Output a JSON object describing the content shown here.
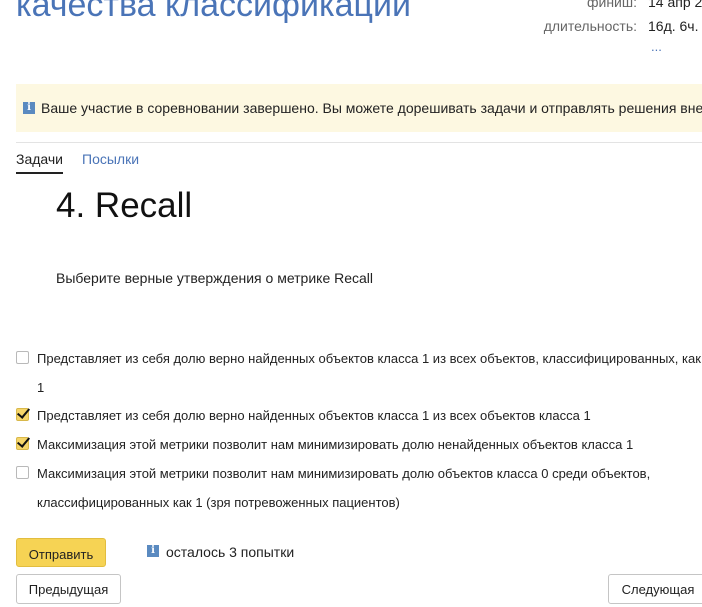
{
  "header": {
    "contest_title": "качества классификации",
    "finish_label": "финиш:",
    "finish_value": "14 апр 2",
    "duration_label": "длительность:",
    "duration_value": "16д. 6ч.",
    "more": "..."
  },
  "notice": {
    "icon": "info-icon",
    "text": "Ваше участие в соревновании завершено. Вы можете дорешивать задачи и отправлять решения вне"
  },
  "tabs": [
    {
      "label": "Задачи",
      "active": true
    },
    {
      "label": "Посылки",
      "active": false
    }
  ],
  "problem": {
    "title": "4. Recall",
    "statement": "Выберите верные утверждения о метрике Recall"
  },
  "options": [
    {
      "text": "Представляет из себя долю верно найденных объектов класса 1 из всех объектов, классифицированных, как 1",
      "checked": false
    },
    {
      "text": "Представляет из себя долю верно найденных объектов класса 1 из всех объектов класса 1",
      "checked": true
    },
    {
      "text": "Максимизация этой метрики позволит нам минимизировать долю ненайденных объектов класса 1",
      "checked": true
    },
    {
      "text": "Максимизация этой метрики позволит нам минимизировать долю объектов класса 0 среди объектов, классифицированных как 1 (зря потревоженных пациентов)",
      "checked": false
    }
  ],
  "actions": {
    "submit_label": "Отправить",
    "attempts_text": "осталось 3 попытки",
    "prev_label": "Предыдущая",
    "next_label": "Следующая"
  },
  "colors": {
    "accent": "#4a74b7",
    "submit_bg": "#f6d354",
    "notice_bg": "#fdf8e1"
  }
}
